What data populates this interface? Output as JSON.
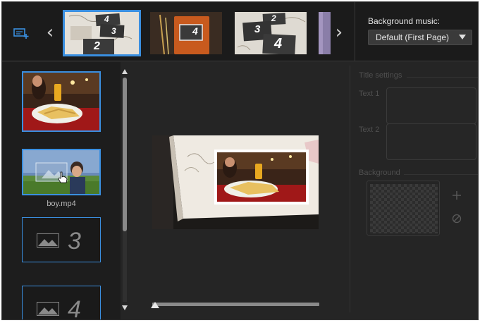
{
  "filmstrip": {
    "thumbnails": [
      {
        "labels": [
          "4",
          "3",
          "2"
        ],
        "selected": true
      },
      {
        "labels": [
          "4"
        ],
        "selected": false
      },
      {
        "labels": [
          "2",
          "3",
          "4"
        ],
        "selected": false
      },
      {
        "labels": [],
        "selected": false
      }
    ]
  },
  "background_music": {
    "label": "Background music:",
    "selected": "Default (First Page)"
  },
  "slots": {
    "video_caption": "boy.mp4",
    "placeholder_3": "3",
    "placeholder_4": "4"
  },
  "title_settings": {
    "section": "Title settings",
    "text1_label": "Text 1",
    "text2_label": "Text 2",
    "background_label": "Background"
  },
  "colors": {
    "accent": "#3a8fe0",
    "window_bg": "#252525",
    "panel_bg": "#1d1d1d"
  },
  "icons": {
    "add_layout": "add-layout-icon",
    "prev": "chevron-left-icon",
    "next": "chevron-right-icon",
    "dropdown": "caret-down-icon",
    "add_background": "plus-icon",
    "no_background": "none-icon",
    "placeholder": "mountain-image-icon",
    "cursor": "hand-cursor-icon"
  }
}
